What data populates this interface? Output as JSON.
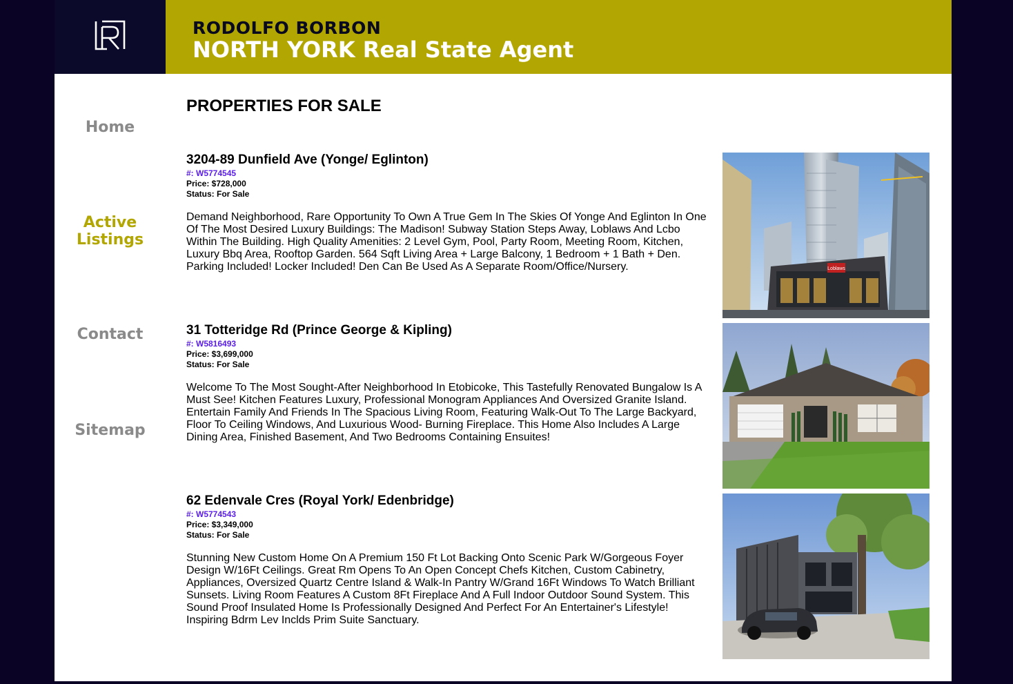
{
  "header": {
    "agent_name": "RODOLFO BORBON",
    "agent_title": "NORTH YORK Real State Agent"
  },
  "nav": {
    "home": "Home",
    "active_line1": "Active",
    "active_line2": "Listings",
    "contact": "Contact",
    "sitemap": "Sitemap"
  },
  "main": {
    "title": "PROPERTIES FOR SALE",
    "listings": [
      {
        "address": "3204-89 Dunfield Ave (Yonge/ Eglinton)",
        "mls": "#: W5774545",
        "price": "Price: $728,000",
        "status": "Status: For Sale",
        "description": "Demand Neighborhood, Rare Opportunity To Own A True Gem In The Skies Of Yonge And Eglinton In One Of The Most Desired Luxury Buildings: The Madison! Subway Station Steps Away, Loblaws And Lcbo Within The Building. High Quality Amenities: 2 Level Gym, Pool, Party Room, Meeting Room, Kitchen, Luxury Bbq Area, Rooftop Garden. 564 Sqft Living Area + Large Balcony, 1 Bedroom + 1 Bath + Den. Parking Included! Locker Included! Den Can Be Used As A Separate Room/Office/Nursery.",
        "photo_store_label": "Loblaws"
      },
      {
        "address": "31 Totteridge Rd (Prince George & Kipling)",
        "mls": "#: W5816493",
        "price": "Price: $3,699,000",
        "status": "Status: For Sale",
        "description": "Welcome To The Most Sought-After Neighborhood In Etobicoke, This Tastefully Renovated Bungalow Is A Must See! Kitchen Features Luxury, Professional Monogram Appliances And Oversized Granite Island. Entertain Family And Friends In The Spacious Living Room, Featuring Walk-Out To The Large Backyard, Floor To Ceiling Windows, And Luxurious Wood- Burning Fireplace. This Home Also Includes A Large Dining Area, Finished Basement, And Two Bedrooms Containing Ensuites!"
      },
      {
        "address": "62 Edenvale Cres (Royal York/ Edenbridge)",
        "mls": "#: W5774543",
        "price": "Price: $3,349,000",
        "status": "Status: For Sale",
        "description": "Stunning New Custom Home On A Premium 150 Ft Lot Backing Onto Scenic Park W/Gorgeous Foyer Design W/16Ft Ceilings. Great Rm Opens To An Open Concept Chefs Kitchen, Custom Cabinetry, Appliances, Oversized Quartz Centre Island & Walk-In Pantry W/Grand 16Ft Windows To Watch Brilliant Sunsets. Living Room Features A Custom 8Ft Fireplace And A Full Indoor Outdoor Sound System. This Sound Proof Insulated Home Is Professionally Designed And Perfect For An Entertainer's Lifestyle! Inspiring Bdrm Lev Inclds Prim Suite Sanctuary."
      }
    ]
  },
  "colors": {
    "background": "#0b0326",
    "header": "#b2a602",
    "logo_box": "#0c0a2b",
    "nav_text": "#8a8a8a",
    "nav_active": "#b2a602",
    "mls_link": "#5a1ee8"
  },
  "icons": {
    "logo": "r-monogram-logo-icon"
  }
}
